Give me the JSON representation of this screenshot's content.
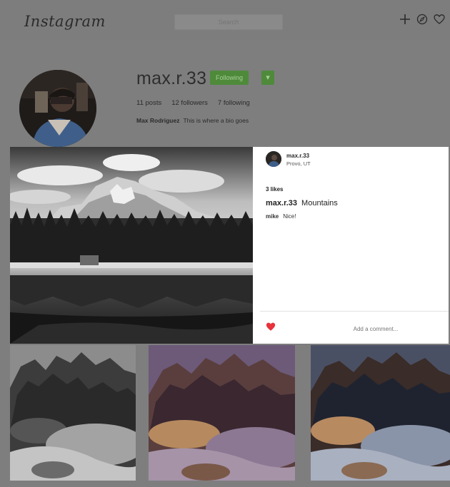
{
  "app": {
    "logo": "Instagram"
  },
  "topbar": {
    "search_placeholder": "Search",
    "icons": [
      "plus-icon",
      "compass-icon",
      "heart-icon"
    ]
  },
  "profile": {
    "username": "max.r.33",
    "follow_label": "Following",
    "follow_caret": "▾",
    "stats": {
      "posts": "11 posts",
      "followers": "12 followers",
      "following": "7 following"
    },
    "bio_name": "Max Rodriguez",
    "bio_text": "This is where a bio goes"
  },
  "post": {
    "user": "max.r.33",
    "location": "Provo, UT",
    "likes": "3 likes",
    "caption_user": "max.r.33",
    "caption": "Mountains",
    "comment_user": "mike",
    "comment_text": "Nice!",
    "add_comment_placeholder": "Add a comment...",
    "liked_color": "#e8323c"
  },
  "grid": {
    "tiles": [
      "mountain-gray",
      "mountain-purple-warm",
      "mountain-blue-warm"
    ]
  }
}
